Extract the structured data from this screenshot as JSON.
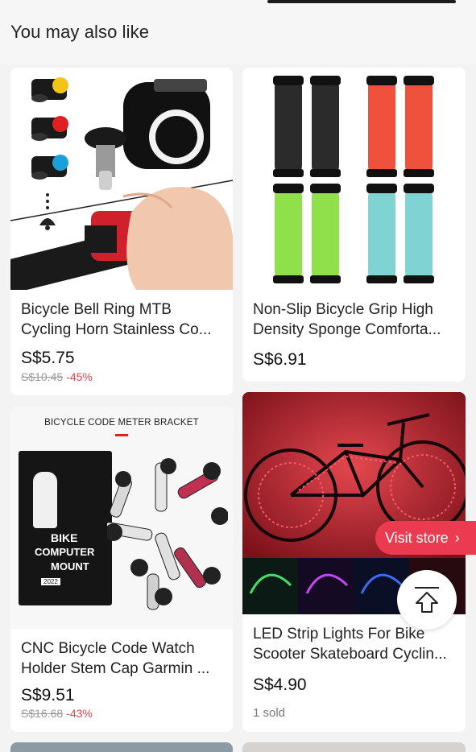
{
  "section": {
    "title": "You may also like"
  },
  "products": [
    {
      "title": "Bicycle Bell Ring MTB Cycling Horn Stainless Co...",
      "price": "S$5.75",
      "original_price": "S$10.45",
      "discount": "-45%"
    },
    {
      "title": "Non-Slip Bicycle Grip High Density Sponge Comforta...",
      "price": "S$6.91"
    },
    {
      "title": "CNC Bicycle Code Watch Holder Stem Cap Garmin ...",
      "price": "S$9.51",
      "original_price": "S$16.68",
      "discount": "-43%",
      "image_caption": "BICYCLE CODE METER BRACKET",
      "box_text": [
        "BIKE",
        "COMPUTER",
        "MOUNT",
        "2022"
      ]
    },
    {
      "title": "LED Strip Lights For Bike Scooter Skateboard Cyclin...",
      "price": "S$4.90",
      "sold": "1 sold"
    }
  ],
  "visit_store": {
    "label": "Visit store",
    "icon": "chevron-right-icon"
  },
  "scroll_top": {
    "icon": "arrow-up-to-top-icon"
  },
  "colors": {
    "accent": "#ec3a50",
    "discount": "#e8424f"
  }
}
